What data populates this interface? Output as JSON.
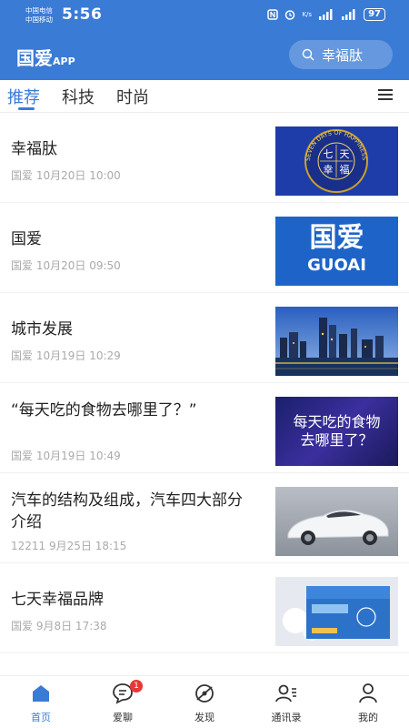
{
  "status_bar": {
    "carrier_1": "中国电信",
    "carrier_2": "中国移动",
    "time": "5:56",
    "net_label": "K/s",
    "battery": "97"
  },
  "header": {
    "logo_main": "国爱",
    "logo_suffix": "APP",
    "search_text": "幸福肽"
  },
  "tabs": [
    {
      "label": "推荐",
      "active": true
    },
    {
      "label": "科技",
      "active": false
    },
    {
      "label": "时尚",
      "active": false
    }
  ],
  "feed": [
    {
      "title": "幸福肽",
      "source": "国爱",
      "date": "10月20日 10:00",
      "thumb": "seven-days-seal"
    },
    {
      "title": "国爱",
      "source": "国爱",
      "date": "10月20日 09:50",
      "thumb": "guoai-logo",
      "thumb_text": "国爱",
      "thumb_sub": "GUOAI"
    },
    {
      "title": "城市发展",
      "source": "国爱",
      "date": "10月19日 10:29",
      "thumb": "city-night"
    },
    {
      "title": "“每天吃的食物去哪里了？”",
      "source": "国爱",
      "date": "10月19日 10:49",
      "thumb": "food-text",
      "thumb_text_1": "每天吃的食物",
      "thumb_text_2": "去哪里了？"
    },
    {
      "title": "汽车的结构及组成，汽车四大部分介绍",
      "source": "12211",
      "date": "9月25日 18:15",
      "thumb": "white-car"
    },
    {
      "title": "七天幸福品牌",
      "source": "国爱",
      "date": "9月8日 17:38",
      "thumb": "product-box"
    }
  ],
  "seal": {
    "ring_text": "SEVEN DAYS OF HAPPINESS",
    "chars": [
      "七",
      "天",
      "幸",
      "福"
    ]
  },
  "bottom_nav": [
    {
      "label": "首页",
      "icon": "home-icon",
      "active": true
    },
    {
      "label": "爱聊",
      "icon": "chat-icon",
      "active": false,
      "badge": "1"
    },
    {
      "label": "发现",
      "icon": "discover-icon",
      "active": false
    },
    {
      "label": "通讯录",
      "icon": "contacts-icon",
      "active": false
    },
    {
      "label": "我的",
      "icon": "profile-icon",
      "active": false
    }
  ],
  "colors": {
    "brand": "#3a7bd5",
    "badge": "#e53935"
  }
}
